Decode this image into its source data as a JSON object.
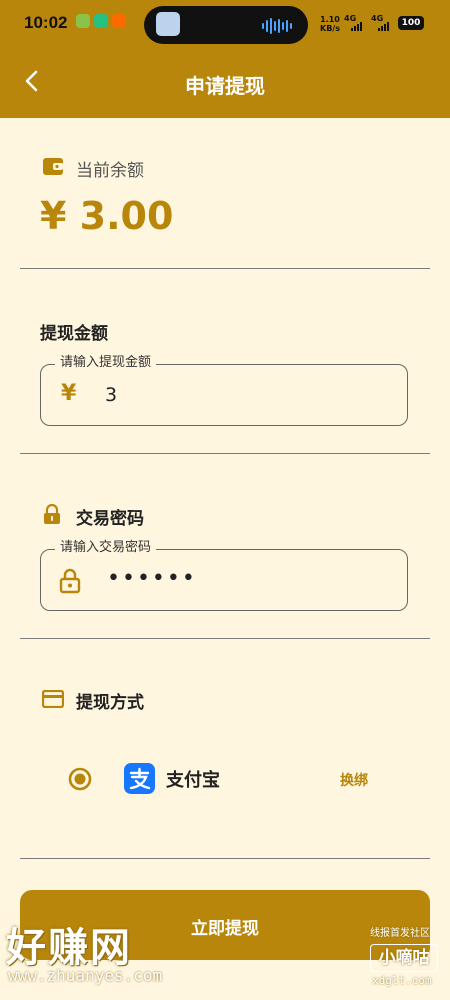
{
  "status_bar": {
    "time": "10:02",
    "speed_value": "1.10",
    "speed_unit": "KB/s",
    "signal1": "4G",
    "signal2": "4G",
    "battery": "100"
  },
  "nav": {
    "title": "申请提现",
    "back_icon": "chevron-left-icon"
  },
  "balance": {
    "label": "当前余额",
    "amount": "¥ 3.00",
    "icon": "wallet-icon"
  },
  "amount_section": {
    "title": "提现金额",
    "field_legend": "请输入提现金额",
    "currency_symbol": "¥",
    "value": "3"
  },
  "password_section": {
    "title": "交易密码",
    "field_legend": "请输入交易密码",
    "masked_value": "••••••",
    "icon": "lock-icon"
  },
  "method_section": {
    "title": "提现方式",
    "icon": "card-icon",
    "option_label": "支付宝",
    "option_icon": "alipay-icon",
    "change_label": "换绑",
    "selected": true
  },
  "submit_label": "立即提现",
  "watermarks": {
    "left_big": "好赚网",
    "left_url": "www.zhuanyes.com",
    "right_top": "线报首发社区",
    "right_box": "小嘀咕",
    "right_url": "xdglt.com"
  },
  "colors": {
    "accent": "#B8860B",
    "background": "#FFF6DF",
    "alipay": "#1677FF"
  }
}
